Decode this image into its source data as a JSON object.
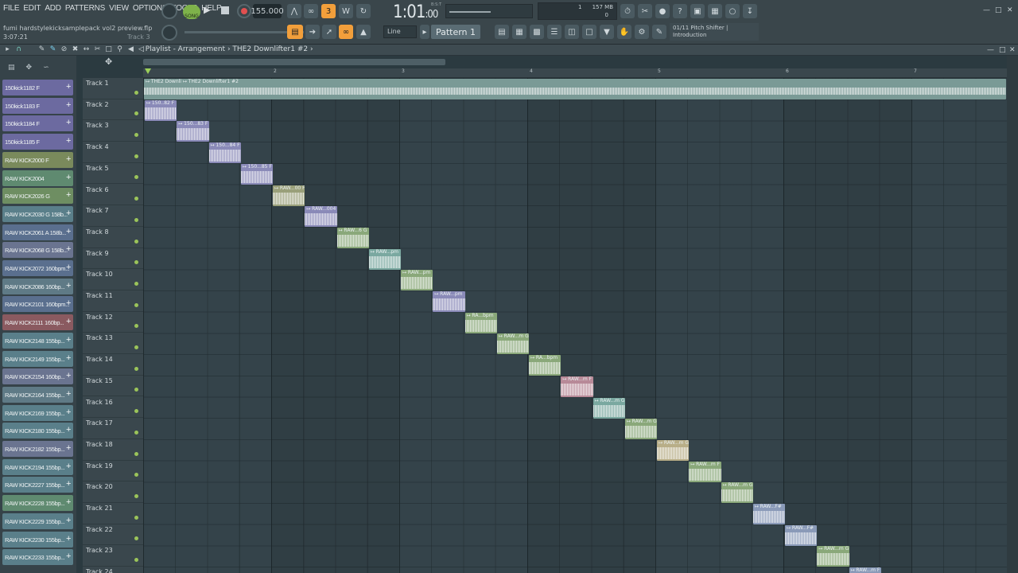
{
  "menu": [
    "FILE",
    "EDIT",
    "ADD",
    "PATTERNS",
    "VIEW",
    "OPTIONS",
    "TOOLS",
    "HELP"
  ],
  "project": {
    "filename": "fumi hardstylekicksamplepack vol2 preview.flp",
    "time": "3:07:21",
    "hint_track": "Track 3"
  },
  "transport": {
    "song_label": "SONG",
    "tempo": "155.000",
    "time_main": "1:01",
    "time_sub": ":00",
    "time_unit": "B:S:T"
  },
  "cpu": {
    "memory": "157 MB",
    "value_a": "1",
    "value_b": "0"
  },
  "snap": {
    "value": "Line"
  },
  "pattern": {
    "name": "Pattern 1"
  },
  "hint_panel": {
    "line1": "01/11  Pitch Shifter |",
    "line2": "Introduction"
  },
  "playlist": {
    "title": "Playlist - Arrangement",
    "clip": "THE2 Downlifter1 #2"
  },
  "ruler_marks": [
    "2",
    "3",
    "4",
    "5",
    "6",
    "7"
  ],
  "channels": [
    {
      "name": "150kick1182 F",
      "color": "#6c6aa0"
    },
    {
      "name": "150kick1183 F",
      "color": "#6c6aa0"
    },
    {
      "name": "150kick1184 F",
      "color": "#6c6aa0"
    },
    {
      "name": "150kick1185 F",
      "color": "#6c6aa0"
    },
    {
      "name": "RAW KICK2000 F",
      "color": "#7a8a5c"
    },
    {
      "name": "RAW KICK2004",
      "color": "#5f8a70"
    },
    {
      "name": "RAW KICK2026 G",
      "color": "#6e8e62"
    },
    {
      "name": "RAW KICK2030 G 158b...",
      "color": "#5a7f8a"
    },
    {
      "name": "RAW KICK2061 A 158b...",
      "color": "#5a6f8e"
    },
    {
      "name": "RAW KICK2068 G 158b...",
      "color": "#6a7490"
    },
    {
      "name": "RAW KICK2072 160bpm...",
      "color": "#5a6f8e"
    },
    {
      "name": "RAW KICK2086 160bp...",
      "color": "#5f7a86"
    },
    {
      "name": "RAW KICK2101 160bpm...",
      "color": "#5a6f8e"
    },
    {
      "name": "RAW KICK2111 160bp...",
      "color": "#8a5a60"
    },
    {
      "name": "RAW KICK2148 155bp...",
      "color": "#5a7f8a"
    },
    {
      "name": "RAW KICK2149 155bp...",
      "color": "#5a7f8a"
    },
    {
      "name": "RAW KICK2154 160bp...",
      "color": "#6a7490"
    },
    {
      "name": "RAW KICK2164 155bp...",
      "color": "#5f7a86"
    },
    {
      "name": "RAW KICK2169 155bp...",
      "color": "#5a7f8a"
    },
    {
      "name": "RAW KICK2180 155bp...",
      "color": "#5a7f8a"
    },
    {
      "name": "RAW KICK2182 155bp...",
      "color": "#6a7490"
    },
    {
      "name": "RAW KICK2194 155bp...",
      "color": "#5a7f8a"
    },
    {
      "name": "RAW KICK2227 155bp...",
      "color": "#5a7f8a"
    },
    {
      "name": "RAW KICK2228 155bp...",
      "color": "#5f8a70"
    },
    {
      "name": "RAW KICK2229 155bp...",
      "color": "#5a7f8a"
    },
    {
      "name": "RAW KICK2230 155bp...",
      "color": "#5a7f8a"
    },
    {
      "name": "RAW KICK2233 155bp...",
      "color": "#5a7f8a"
    }
  ],
  "tracks": [
    "Track 1",
    "Track 2",
    "Track 3",
    "Track 4",
    "Track 5",
    "Track 6",
    "Track 7",
    "Track 8",
    "Track 9",
    "Track 10",
    "Track 11",
    "Track 12",
    "Track 13",
    "Track 14",
    "Track 15",
    "Track 16",
    "Track 17",
    "Track 18",
    "Track 19",
    "Track 20",
    "Track 21",
    "Track 22",
    "Track 23",
    "Track 24"
  ],
  "clips": [
    {
      "label": "150..82 F",
      "color": "#8a8ab8"
    },
    {
      "label": "150...83 F",
      "color": "#8a8ab8"
    },
    {
      "label": "150...84 F",
      "color": "#8a8ab8"
    },
    {
      "label": "150...85 F",
      "color": "#8a8ab8"
    },
    {
      "label": "RAW...00 F",
      "color": "#9aa07a"
    },
    {
      "label": "RAW...004",
      "color": "#8a8ab8"
    },
    {
      "label": "RAW...6 G",
      "color": "#8aa87a"
    },
    {
      "label": "RAW...pm",
      "color": "#7aa8a0"
    },
    {
      "label": "RAW...pm",
      "color": "#8aa87a"
    },
    {
      "label": "RAW...pm",
      "color": "#8a8ab8"
    },
    {
      "label": "RA...bpm",
      "color": "#8aa87a"
    },
    {
      "label": "RAW...m G",
      "color": "#8aa87a"
    },
    {
      "label": "RA...bpm",
      "color": "#8aa87a"
    },
    {
      "label": "RAW...m F",
      "color": "#b88a98"
    },
    {
      "label": "RAW...m G",
      "color": "#7aa8a0"
    },
    {
      "label": "RAW...m G",
      "color": "#8aa87a"
    },
    {
      "label": "RAW...m G",
      "color": "#b8ae88"
    },
    {
      "label": "RAW...m F",
      "color": "#8aa87a"
    },
    {
      "label": "RAW...m G",
      "color": "#8aa87a"
    },
    {
      "label": "RAW...F#",
      "color": "#8a9ab8"
    },
    {
      "label": "RAW...F#",
      "color": "#8a9ab8"
    },
    {
      "label": "RAW...m G",
      "color": "#8aa87a"
    },
    {
      "label": "RAW...m F",
      "color": "#8a9ab8"
    }
  ],
  "track1_clip": {
    "label_a": "THE2 Downli",
    "label_b": "THE2 Downlifter1 #2",
    "color": "#7a9a96"
  }
}
